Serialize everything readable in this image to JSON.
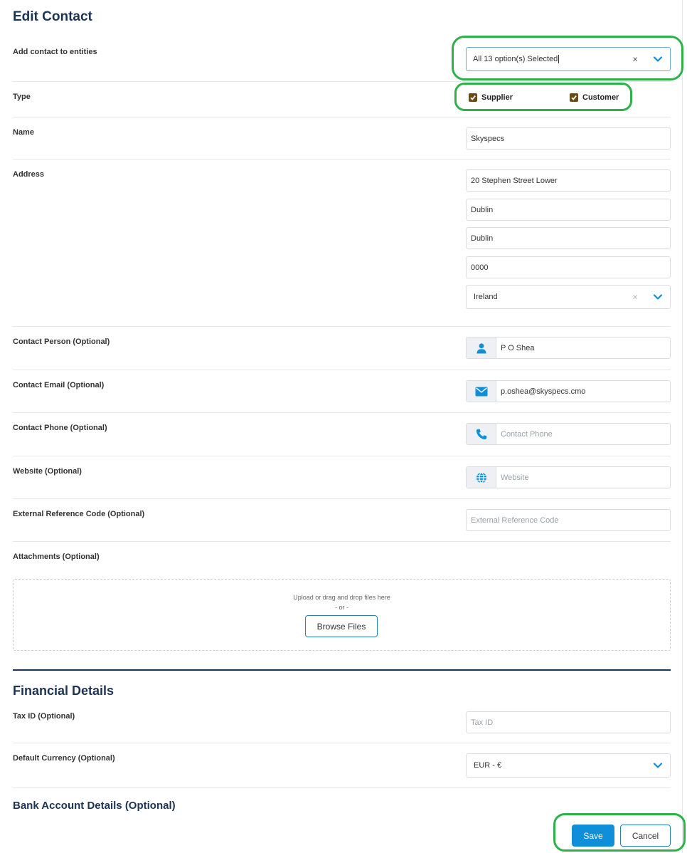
{
  "page": {
    "title": "Edit Contact"
  },
  "entities": {
    "label": "Add contact to entities",
    "value": "All 13 option(s) Selected",
    "clear": "×"
  },
  "type": {
    "label": "Type",
    "options": [
      {
        "label": "Supplier",
        "checked": true
      },
      {
        "label": "Customer",
        "checked": true
      }
    ]
  },
  "name": {
    "label": "Name",
    "value": "Skyspecs"
  },
  "address": {
    "label": "Address",
    "line1": "20 Stephen Street Lower",
    "city": "Dublin",
    "county": "Dublin",
    "postcode": "0000",
    "country": "Ireland",
    "clear": "×"
  },
  "contact_person": {
    "label": "Contact Person (Optional)",
    "value": "P O Shea",
    "icon": "person-icon"
  },
  "contact_email": {
    "label": "Contact Email (Optional)",
    "value": "p.oshea@skyspecs.cmo",
    "icon": "envelope-icon"
  },
  "contact_phone": {
    "label": "Contact Phone (Optional)",
    "placeholder": "Contact Phone",
    "icon": "phone-icon"
  },
  "website": {
    "label": "Website (Optional)",
    "placeholder": "Website",
    "icon": "globe-icon"
  },
  "external_ref": {
    "label": "External Reference Code (Optional)",
    "placeholder": "External Reference Code"
  },
  "attachments": {
    "label": "Attachments (Optional)",
    "hint": "Upload or drag and drop files here",
    "or": "- or -",
    "browse_label": "Browse Files"
  },
  "financial": {
    "title": "Financial Details",
    "tax_label": "Tax ID (Optional)",
    "tax_placeholder": "Tax ID",
    "currency_label": "Default Currency (Optional)",
    "currency_value": "EUR - €",
    "bank_title": "Bank Account Details (Optional)"
  },
  "actions": {
    "save_label": "Save",
    "cancel_label": "Cancel"
  },
  "colors": {
    "accent": "#0f8fda",
    "heading": "#1c3454",
    "checkbox": "#6b4a14",
    "highlight": "#2db24a"
  }
}
